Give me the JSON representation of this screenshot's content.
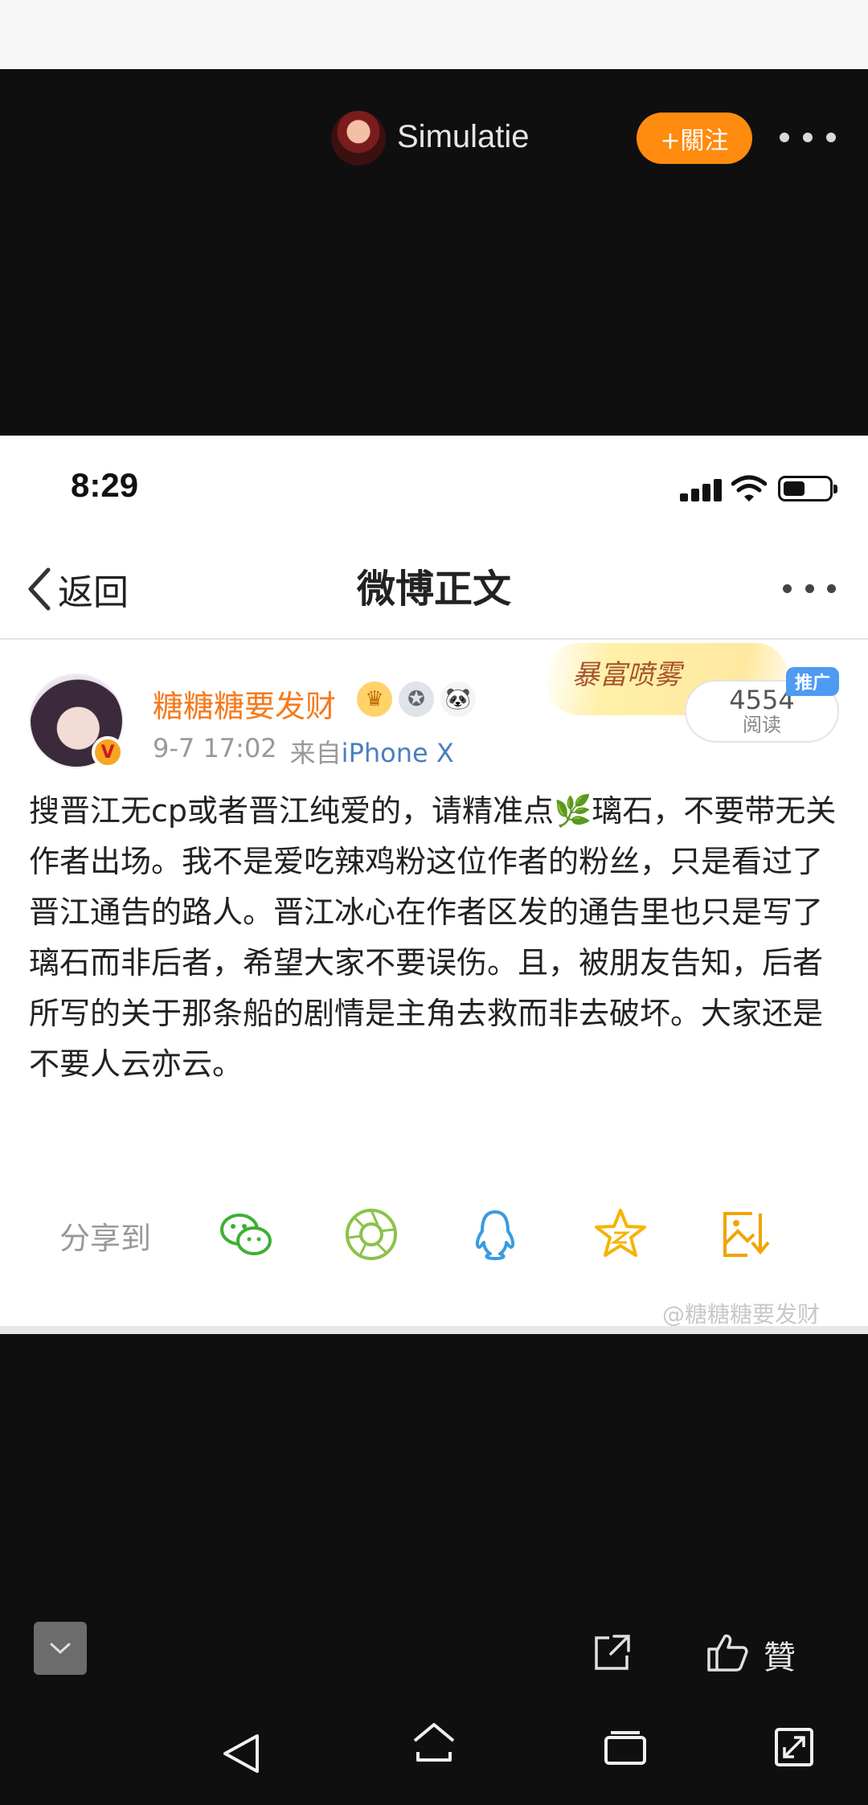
{
  "viewer": {
    "author": "Simulatie",
    "follow_label": "+關注",
    "like_label": "贊"
  },
  "status_bar": {
    "time": "8:29"
  },
  "nav": {
    "back_label": "返回",
    "title": "微博正文"
  },
  "post": {
    "user_name": "糖糖糖要发财",
    "date": "9-7 17:02",
    "source_prefix": "来自",
    "device": "iPhone X",
    "promo_text": "暴富喷雾",
    "ad_tag": "推广",
    "read_count": "4554",
    "read_label": "阅读",
    "body": "搜晋江无cp或者晋江纯爱的，请精准点🌿璃石，不要带无关作者出场。我不是爱吃辣鸡粉这位作者的粉丝，只是看过了晋江通告的路人。晋江冰心在作者区发的通告里也只是写了璃石而非后者，希望大家不要误伤。且，被朋友告知，后者所写的关于那条船的剧情是主角去救而非去破坏。大家还是不要人云亦云。"
  },
  "share": {
    "label": "分享到",
    "targets": [
      "wechat-icon",
      "moments-icon",
      "qq-icon",
      "qzone-icon",
      "save-image-icon"
    ]
  },
  "watermark": "@糖糖糖要发财",
  "colors": {
    "follow": "#ff8b0f",
    "username": "#f57a1c",
    "device_link": "#4a7fbf",
    "wechat": "#3cb034",
    "moments": "#8bc34a",
    "qq": "#3a9ae0",
    "qzone": "#f5b400",
    "save": "#f0a500"
  }
}
